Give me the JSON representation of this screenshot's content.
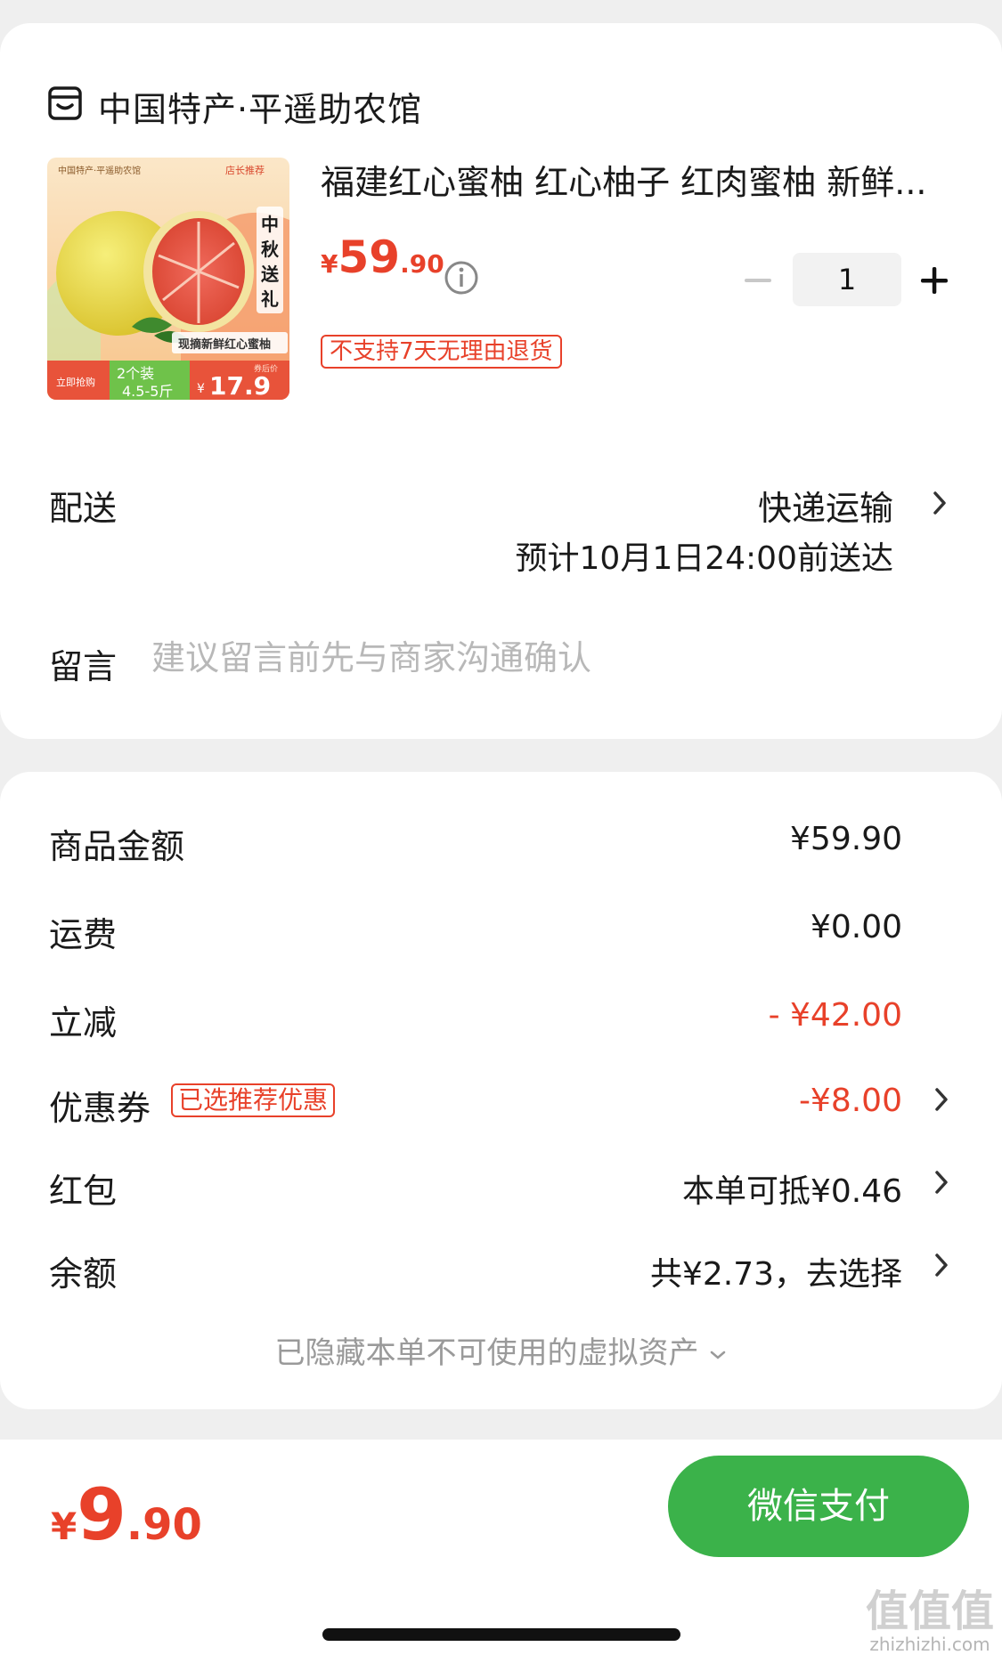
{
  "shop": {
    "name": "中国特产·平遥助农馆",
    "icon": "shop-icon"
  },
  "product": {
    "title": "福建红心蜜柚 红心柚子 红肉蜜柚 新鲜...",
    "price_currency": "¥",
    "price_integer": "59",
    "price_decimal": ".90",
    "quantity": "1",
    "no_return_tag": "不支持7天无理由退货",
    "image": {
      "brand_line": "中国特产·平遥助农馆",
      "badge": "店长推荐",
      "vertical_text": "中秋送礼",
      "caption": "现摘新鲜红心蜜柚",
      "buy_now": "立即抢购",
      "pack": "2个装",
      "weight": "4.5-5斤",
      "promo_price_currency": "¥",
      "promo_price": "17.9",
      "promo_label": "券后价"
    }
  },
  "delivery": {
    "label": "配送",
    "method": "快递运输",
    "eta": "预计10月1日24:00前送达"
  },
  "message": {
    "label": "留言",
    "placeholder": "建议留言前先与商家沟通确认"
  },
  "costs": {
    "goods_label": "商品金额",
    "goods_value": "¥59.90",
    "shipping_label": "运费",
    "shipping_value": "¥0.00",
    "discount_label": "立减",
    "discount_value": "- ¥42.00",
    "coupon_label": "优惠券",
    "coupon_tag": "已选推荐优惠",
    "coupon_value": "-¥8.00",
    "redpacket_label": "红包",
    "redpacket_value": "本单可抵¥0.46",
    "balance_label": "余额",
    "balance_value": "共¥2.73，去选择",
    "hidden_assets": "已隐藏本单不可使用的虚拟资产"
  },
  "footer": {
    "total_currency": "¥",
    "total_integer": "9",
    "total_decimal": ".90",
    "pay_button": "微信支付"
  },
  "watermark": {
    "mark": "值值值",
    "url": "zhizhizhi.com"
  },
  "colors": {
    "accent_red": "#e8412a",
    "pay_green": "#3bb24a",
    "background": "#efefef"
  }
}
